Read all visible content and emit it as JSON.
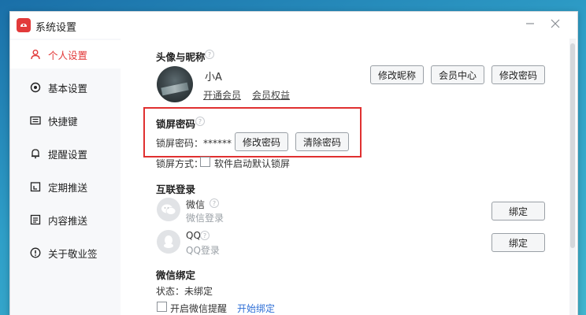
{
  "window": {
    "title": "系统设置"
  },
  "sidebar": {
    "items": [
      {
        "label": "个人设置",
        "icon": "user-icon",
        "active": true
      },
      {
        "label": "基本设置",
        "icon": "settings-icon",
        "active": false
      },
      {
        "label": "快捷键",
        "icon": "keyboard-icon",
        "active": false
      },
      {
        "label": "提醒设置",
        "icon": "bell-icon",
        "active": false
      },
      {
        "label": "定期推送",
        "icon": "calendar-icon",
        "active": false
      },
      {
        "label": "内容推送",
        "icon": "document-icon",
        "active": false
      },
      {
        "label": "关于敬业签",
        "icon": "info-icon",
        "active": false
      }
    ]
  },
  "avatar_section": {
    "title": "头像与昵称",
    "nickname": "小A",
    "links": [
      "开通会员",
      "会员权益"
    ],
    "buttons": [
      "修改昵称",
      "会员中心",
      "修改密码"
    ]
  },
  "lock_section": {
    "title": "锁屏密码",
    "password_label": "锁屏密码：******",
    "buttons": [
      "修改密码",
      "清除密码"
    ],
    "mode_label": "锁屏方式：",
    "checkbox_label": "软件启动默认锁屏",
    "checkbox_checked": false
  },
  "login_section": {
    "title": "互联登录",
    "accounts": [
      {
        "name": "微信",
        "sub": "微信登录",
        "button": "绑定",
        "icon": "wechat-icon"
      },
      {
        "name": "QQ",
        "sub": "QQ登录",
        "button": "绑定",
        "icon": "qq-icon"
      }
    ]
  },
  "wechat_bind": {
    "title": "微信绑定",
    "status": "状态：未绑定",
    "checkbox_label": "开启微信提醒",
    "action": "开始绑定"
  },
  "colors": {
    "accent": "#e23a3a",
    "highlight": "#e03030",
    "link_blue": "#2f6fd6"
  }
}
